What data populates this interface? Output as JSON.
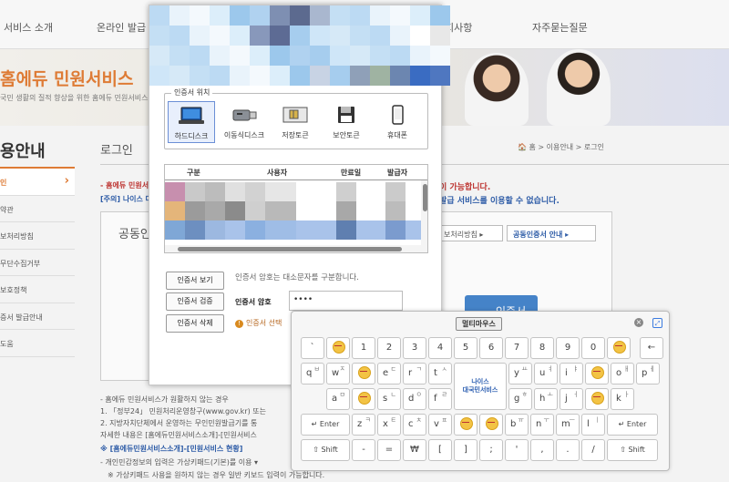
{
  "background": {
    "nav": [
      "서비스 소개",
      "온라인 발급",
      "지사항",
      "자주묻는질문"
    ],
    "banner_title": "홈에듀 민원서비스",
    "banner_sub": "국민 생활의 질적 향상을 위한 홈에듀 민원서비스",
    "sidebar_title": "용안내",
    "sidebar_items": [
      "인",
      "약관",
      "보처리방침",
      "무단수집거부",
      "보호정책",
      "증서 발급안내",
      "도움"
    ],
    "page_title": "로그인",
    "breadcrumb": "🏠 홈 > 이용안내 > 로그인",
    "notice1": "- 홈에듀 민원서비스는 공동인증서로 로그인 하셔야",
    "notice1_tail": "이 가능합니다.",
    "notice2": "[주의] 나이스 대국민서비스",
    "notice2_tail": "발급 서비스를 이용할 수 없습니다.",
    "login_box_title": "공동인",
    "btn_policy": "보처리방침 ▸",
    "btn_cert_guide": "공동인증서 안내 ▸",
    "btn_login": "인증서",
    "footer": [
      "- 홈에듀 민원서비스가 원활하지 않는 경우",
      "1. 「정부24」 민원처리운영창구(www.gov.kr) 또는",
      "2. 지방자치단체에서 운영하는 무인민원발급기를 통",
      "자세한 내용은 [홈에듀민원서비스소개]-[민원서비스",
      "※ [홈에듀민원서비스소개]-[민원서비스 현황]",
      "- 개인민감정보의 입력은 가상키패드(기본)를 이용 ▾",
      "※ 가상키패드 사용을 원하지 않는 경우 일반 키보드 입력이 가능합니다."
    ]
  },
  "dialog": {
    "location_legend": "인증서 위치",
    "locations": [
      {
        "label": "하드디스크",
        "icon": "laptop-icon",
        "selected": true
      },
      {
        "label": "이동식디스크",
        "icon": "usb-drive-icon",
        "selected": false
      },
      {
        "label": "저장토큰",
        "icon": "security-token-icon",
        "selected": false
      },
      {
        "label": "보안토큰",
        "icon": "floppy-disk-icon",
        "selected": false
      },
      {
        "label": "휴대폰",
        "icon": "mobile-phone-icon",
        "selected": false
      }
    ],
    "table_headers": [
      "구분",
      "사용자",
      "만료일",
      "발급자"
    ],
    "buttons": {
      "view": "인증서 보기",
      "verify": "인증서 검증",
      "delete": "인증서 삭제"
    },
    "password_hint": "인증서 암호는 대소문자를 구분합니다.",
    "password_label": "인증서 암호",
    "password_value": "••••",
    "warning": "인증서 선택"
  },
  "keyboard": {
    "title": "멀티마우스",
    "close_icon": "close-icon",
    "brand": "나이스\n대국민서비스",
    "rows": [
      [
        "`",
        "EMO",
        "1",
        "2",
        "3",
        "4",
        "5",
        "6",
        "7",
        "8",
        "9",
        "0",
        "EMO",
        "←"
      ],
      [
        "q",
        "w",
        "EMO",
        "e",
        "r",
        "t",
        "BRAND",
        "y",
        "u",
        "i",
        "EMO",
        "o",
        "p"
      ],
      [
        "a",
        "EMO",
        "s",
        "d",
        "f",
        "BRAND2",
        "g",
        "h",
        "j",
        "EMO",
        "k"
      ],
      [
        "Enter",
        "z",
        "x",
        "c",
        "v",
        "EMO",
        "EMO",
        "b",
        "n",
        "m",
        "l",
        "Enter"
      ],
      [
        "Shift",
        "-",
        "=",
        "₩",
        "[",
        "]",
        ";",
        "'",
        ",",
        ".",
        "/",
        "Shift"
      ]
    ],
    "shifted": {
      "q": "ㅂ",
      "w": "ㅈ",
      "e": "ㄷ",
      "r": "ㄱ",
      "t": "ㅅ",
      "y": "ㅛ",
      "u": "ㅕ",
      "i": "ㅑ",
      "o": "ㅐ",
      "p": "ㅔ",
      "a": "ㅁ",
      "s": "ㄴ",
      "d": "ㅇ",
      "f": "ㄹ",
      "g": "ㅎ",
      "h": "ㅗ",
      "j": "ㅓ",
      "k": "ㅏ",
      "l": "ㅣ",
      "z": "ㅋ",
      "x": "ㅌ",
      "c": "ㅊ",
      "v": "ㅍ",
      "b": "ㅠ",
      "n": "ㅜ",
      "m": "ㅡ"
    }
  }
}
